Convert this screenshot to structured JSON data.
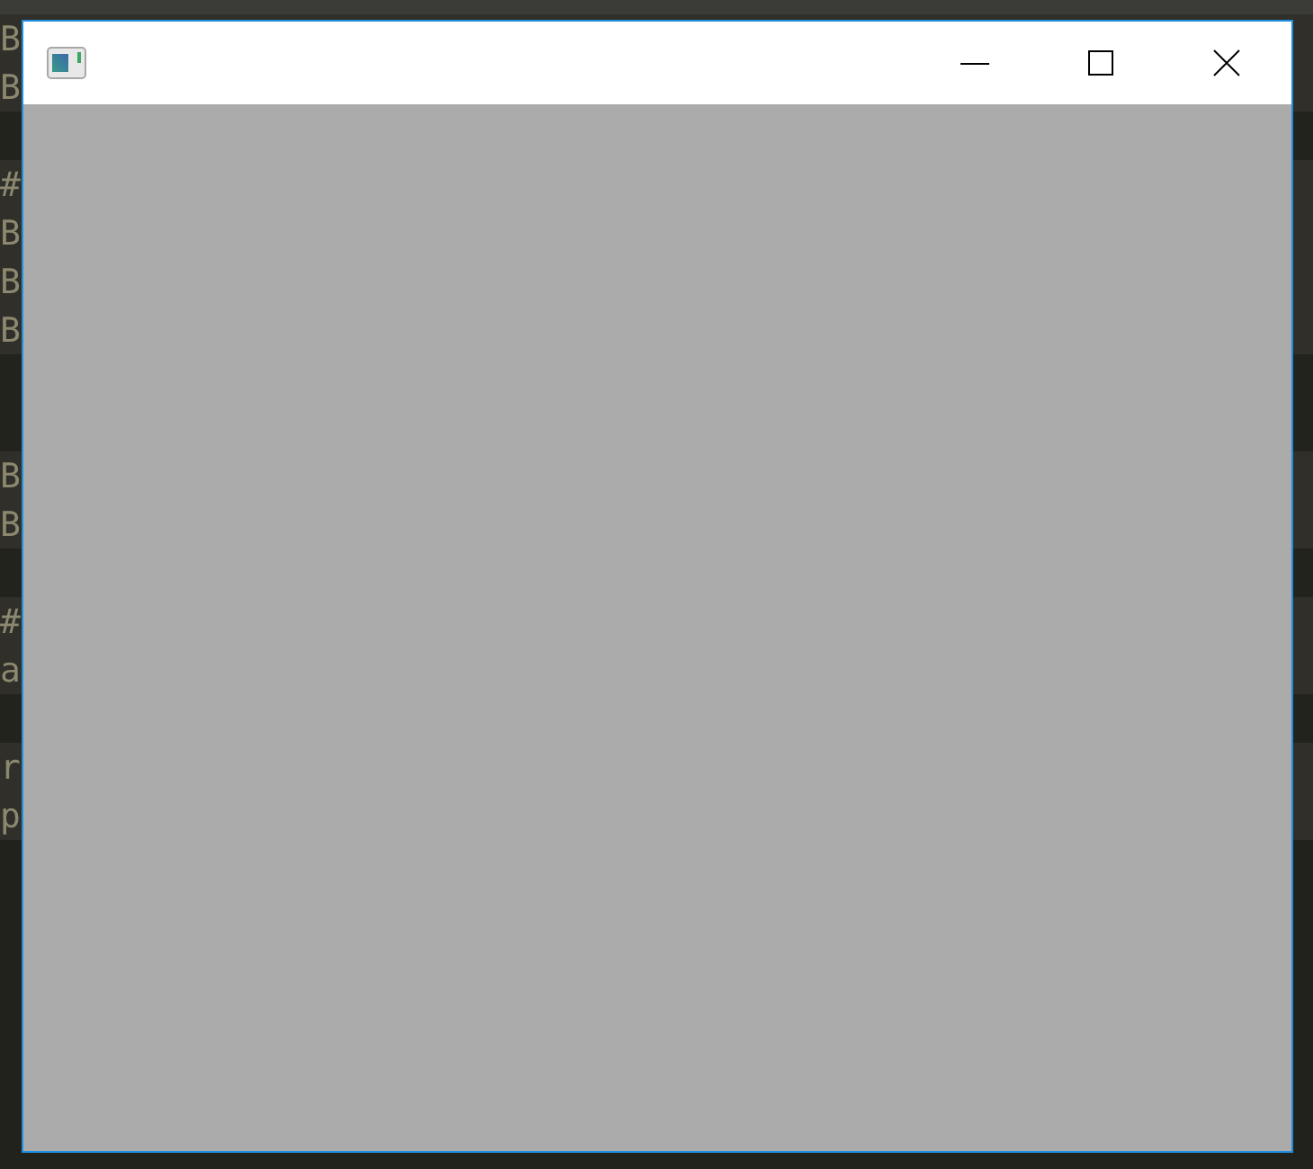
{
  "editor_lines": [
    {
      "kind": "code",
      "left": "B"
    },
    {
      "kind": "code",
      "left": "B"
    },
    {
      "kind": "blank"
    },
    {
      "kind": "code",
      "left": "#"
    },
    {
      "kind": "code",
      "left": "B"
    },
    {
      "kind": "code",
      "left": "B"
    },
    {
      "kind": "code",
      "left": "B"
    },
    {
      "kind": "blank"
    },
    {
      "kind": "blank"
    },
    {
      "kind": "code",
      "left": "B"
    },
    {
      "kind": "code",
      "left": "B"
    },
    {
      "kind": "blank"
    },
    {
      "kind": "code",
      "left": "#"
    },
    {
      "kind": "code",
      "left": "a"
    },
    {
      "kind": "blank"
    },
    {
      "kind": "code",
      "left": "r"
    },
    {
      "kind": "code",
      "left": "p"
    }
  ],
  "window": {
    "active": true
  }
}
